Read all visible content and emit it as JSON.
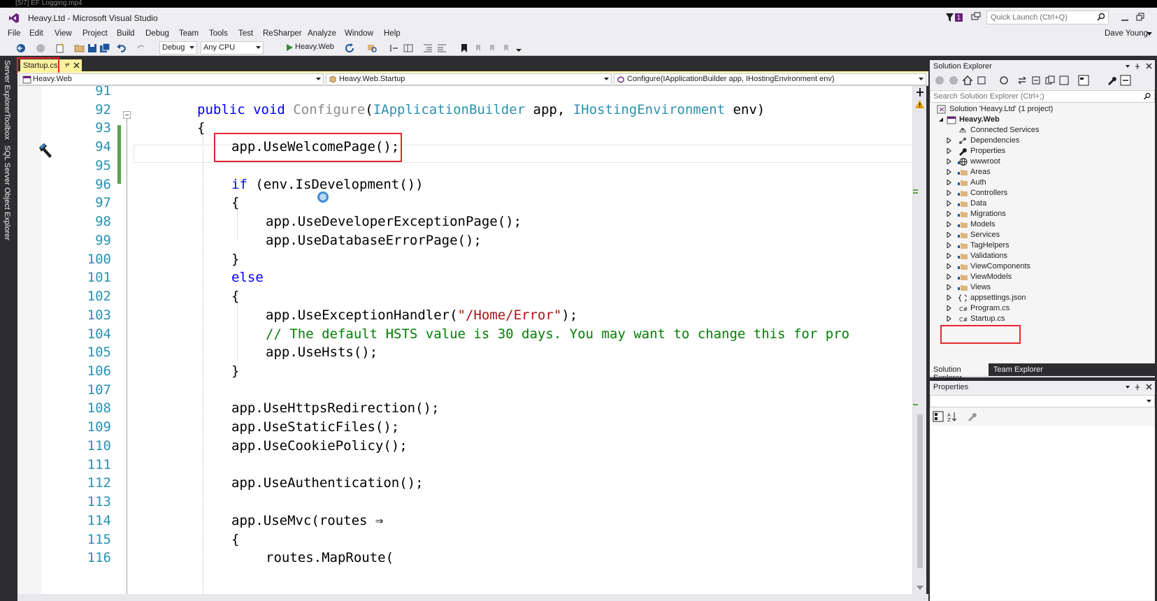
{
  "window": {
    "top_strip_text": "[5/7] EF Logging.mp4",
    "title": "Heavy.Ltd - Microsoft Visual Studio",
    "notification_count": "1",
    "quick_launch_placeholder": "Quick Launch (Ctrl+Q)",
    "user_name": "Dave Young"
  },
  "menu": [
    "File",
    "Edit",
    "View",
    "Project",
    "Build",
    "Debug",
    "Team",
    "Tools",
    "Test",
    "ReSharper",
    "Analyze",
    "Window",
    "Help"
  ],
  "toolbar": {
    "configuration": "Debug",
    "platform": "Any CPU",
    "start_label": "Heavy.Web"
  },
  "left_tool_tabs": [
    "Server Explorer",
    "Toolbox",
    "SQL Server Object Explorer"
  ],
  "document_tab": {
    "label": "Startup.cs"
  },
  "navigation": {
    "project": "Heavy.Web",
    "type": "Heavy.Web.Startup",
    "member": "Configure(IApplicationBuilder app, IHostingEnvironment env)"
  },
  "code": {
    "line_numbers": [
      "91",
      "92",
      "93",
      "94",
      "95",
      "96",
      "97",
      "98",
      "99",
      "100",
      "101",
      "102",
      "103",
      "104",
      "105",
      "106",
      "107",
      "108",
      "109",
      "110",
      "111",
      "112",
      "113",
      "114",
      "115",
      "116"
    ],
    "l92": {
      "kw1": "public",
      "kw2": "void",
      "method": "Configure",
      "open": "(",
      "t1": "IApplicationBuilder",
      "p1": " app, ",
      "t2": "IHostingEnvironment",
      "p2": " env)"
    },
    "l93": "{",
    "l94": "app.UseWelcomePage();",
    "l96": {
      "kw": "if",
      "rest": " (env.IsDevelopment())"
    },
    "l97": "{",
    "l98": "app.UseDeveloperExceptionPage();",
    "l99": "app.UseDatabaseErrorPage();",
    "l100": "}",
    "l101": "else",
    "l102": "{",
    "l103": {
      "pre": "app.UseExceptionHandler(",
      "str": "\"/Home/Error\"",
      "post": ");"
    },
    "l104": "// The default HSTS value is 30 days. You may want to change this for pro",
    "l105": "app.UseHsts();",
    "l106": "}",
    "l108": "app.UseHttpsRedirection();",
    "l109": "app.UseStaticFiles();",
    "l110": "app.UseCookiePolicy();",
    "l112": "app.UseAuthentication();",
    "l114": "app.UseMvc(routes ⇒",
    "l115": "{",
    "l116": "routes.MapRoute("
  },
  "solution_explorer": {
    "title": "Solution Explorer",
    "search_placeholder": "Search Solution Explorer (Ctrl+;)",
    "solution": "Solution 'Heavy.Ltd' (1 project)",
    "project": "Heavy.Web",
    "items": [
      "Connected Services",
      "Dependencies",
      "Properties",
      "wwwroot",
      "Areas",
      "Auth",
      "Controllers",
      "Data",
      "Migrations",
      "Models",
      "Services",
      "TagHelpers",
      "Validations",
      "ViewComponents",
      "ViewModels",
      "Views",
      "appsettings.json",
      "Program.cs",
      "Startup.cs"
    ],
    "tab_solution": "Solution Explorer",
    "tab_team": "Team Explorer"
  },
  "properties": {
    "title": "Properties"
  },
  "colors": {
    "keyword": "#0000ff",
    "type": "#2b91af",
    "string": "#a31515",
    "comment": "#008000",
    "highlight_red": "#e8262d",
    "tab_active": "#fff29d"
  }
}
